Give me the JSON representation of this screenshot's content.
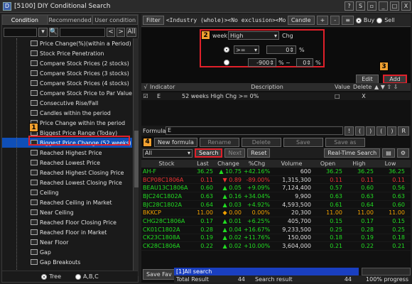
{
  "window": {
    "title": "[5100] DIY Conditional Search",
    "icon_label": "D"
  },
  "window_buttons": [
    "?",
    "S",
    "▫",
    "_",
    "□",
    "X"
  ],
  "left_tabs": [
    {
      "label": "Condition"
    },
    {
      "label": "Recommended"
    },
    {
      "label": "User condition"
    }
  ],
  "left_nav": {
    "prev": "<",
    "next": ">",
    "all": "All"
  },
  "tree_items": [
    "Price Change(%)(within a Period)",
    "Stock Price Penetration",
    "Compare Stock Prices (2 stocks)",
    "Compare Stock Prices (3 stocks)",
    "Compare Stock Prices (4 stocks)",
    "Compare Stock Price to Par Value",
    "Consecutive Rise/Fall",
    "Candles within the period",
    "Price Change within the period",
    "Biggest Price Range (Today)",
    "Biggest Price Change (52 weeks)",
    "Reached Highest Price",
    "Reached Lowest Price",
    "Reached Highest Closing Price",
    "Reached Lowest Closing Price",
    "Ceiling",
    "Reached Ceiling in Market",
    "Near Ceiling",
    "Reached Floor Closing Price",
    "Reached Floor in Market",
    "Near Floor",
    "Gap",
    "Gap Breakouts"
  ],
  "selected_index": 10,
  "view_options": {
    "tree": "Tree",
    "abc": "A,B,C"
  },
  "filter_bar": {
    "filter": "Filter",
    "text": "<Industry (whole)><No exclusion><Monthly s",
    "candle": "Candle",
    "plus": "+",
    "minus": "-",
    "buy": "Buy",
    "sell": "Sell"
  },
  "condition": {
    "week_label": "week",
    "field": "High",
    "field_suffix": "Chg",
    "op": ">=",
    "value1": "0",
    "unit1": "%",
    "low": "-900",
    "mid": "% ~",
    "high": "0",
    "unit2": "%"
  },
  "buttons": {
    "edit": "Edit",
    "add": "Add"
  },
  "badges": [
    "1",
    "2",
    "3",
    "4"
  ],
  "indicator_header": {
    "check": "√",
    "indicator": "Indicator",
    "description": "Description",
    "value": "Value",
    "delete": "Delete"
  },
  "indicator_row": {
    "indicator": "E",
    "description": "52 weeks High Chg >= 0%",
    "delete": "X"
  },
  "formula": {
    "label": "Formula",
    "value": "E",
    "symbols": [
      "!",
      "(",
      ")",
      "(",
      ")",
      "R"
    ]
  },
  "formula_buttons": [
    "New formula",
    "Rename",
    "Delete",
    "Save",
    "Save as"
  ],
  "result_bar": {
    "filter": "All",
    "search": "Search",
    "next": "Next",
    "reset": "Reset",
    "realtime": "Real-Time Search"
  },
  "grid_header": [
    "Stock",
    "Last",
    "Change",
    "%Chg",
    "Volume",
    "Open",
    "High",
    "Low"
  ],
  "rows": [
    {
      "stock": "AH-F",
      "last": "36.25",
      "arrow": "▲",
      "change": "10.75",
      "pct": "+42.16%",
      "vol": "600",
      "open": "36.25",
      "high": "36.25",
      "low": "36.25",
      "dir": "up"
    },
    {
      "stock": "BCP08C1806A",
      "last": "0.11",
      "arrow": "▼",
      "change": "0.89",
      "pct": "-89.00%",
      "vol": "1,315,300",
      "open": "0.11",
      "high": "0.11",
      "low": "0.11",
      "dir": "dn"
    },
    {
      "stock": "BEAU13C1806A",
      "last": "0.60",
      "arrow": "▲",
      "change": "0.05",
      "pct": "+9.09%",
      "vol": "7,124,400",
      "open": "0.57",
      "high": "0.60",
      "low": "0.56",
      "dir": "up"
    },
    {
      "stock": "BJC24C1802A",
      "last": "0.63",
      "arrow": "▲",
      "change": "0.16",
      "pct": "+34.04%",
      "vol": "9,900",
      "open": "0.63",
      "high": "0.63",
      "low": "0.63",
      "dir": "up"
    },
    {
      "stock": "BJC28C1802A",
      "last": "0.64",
      "arrow": "▲",
      "change": "0.03",
      "pct": "+4.92%",
      "vol": "4,593,500",
      "open": "0.61",
      "high": "0.64",
      "low": "0.60",
      "dir": "up"
    },
    {
      "stock": "BKKCP",
      "last": "11.00",
      "arrow": "◆",
      "change": "0.00",
      "pct": "0.00%",
      "vol": "20,300",
      "open": "11.00",
      "high": "11.00",
      "low": "11.00",
      "dir": "fl"
    },
    {
      "stock": "CHG28C1806A",
      "last": "0.17",
      "arrow": "▲",
      "change": "0.01",
      "pct": "+6.25%",
      "vol": "405,700",
      "open": "0.15",
      "high": "0.17",
      "low": "0.15",
      "dir": "up"
    },
    {
      "stock": "CK01C1802A",
      "last": "0.28",
      "arrow": "▲",
      "change": "0.04",
      "pct": "+16.67%",
      "vol": "9,233,500",
      "open": "0.25",
      "high": "0.28",
      "low": "0.25",
      "dir": "up"
    },
    {
      "stock": "CK23C1808A",
      "last": "0.19",
      "arrow": "▲",
      "change": "0.02",
      "pct": "+11.76%",
      "vol": "150,000",
      "open": "0.18",
      "high": "0.19",
      "low": "0.18",
      "dir": "up"
    },
    {
      "stock": "CK28C1806A",
      "last": "0.22",
      "arrow": "▲",
      "change": "0.02",
      "pct": "+10.00%",
      "vol": "3,604,000",
      "open": "0.21",
      "high": "0.22",
      "low": "0.21",
      "dir": "up"
    }
  ],
  "status": {
    "save_fav": "Save Fav",
    "all_search": "[1]All search",
    "total_label": "Total Result",
    "total": "44",
    "search_label": "Search result",
    "search": "44",
    "progress": "100% progress"
  },
  "colors": {
    "up": "#22dd22",
    "down": "#ee3333",
    "flat": "#f0a000",
    "highlight": "#e0202a",
    "selected": "#0f4fb8"
  }
}
